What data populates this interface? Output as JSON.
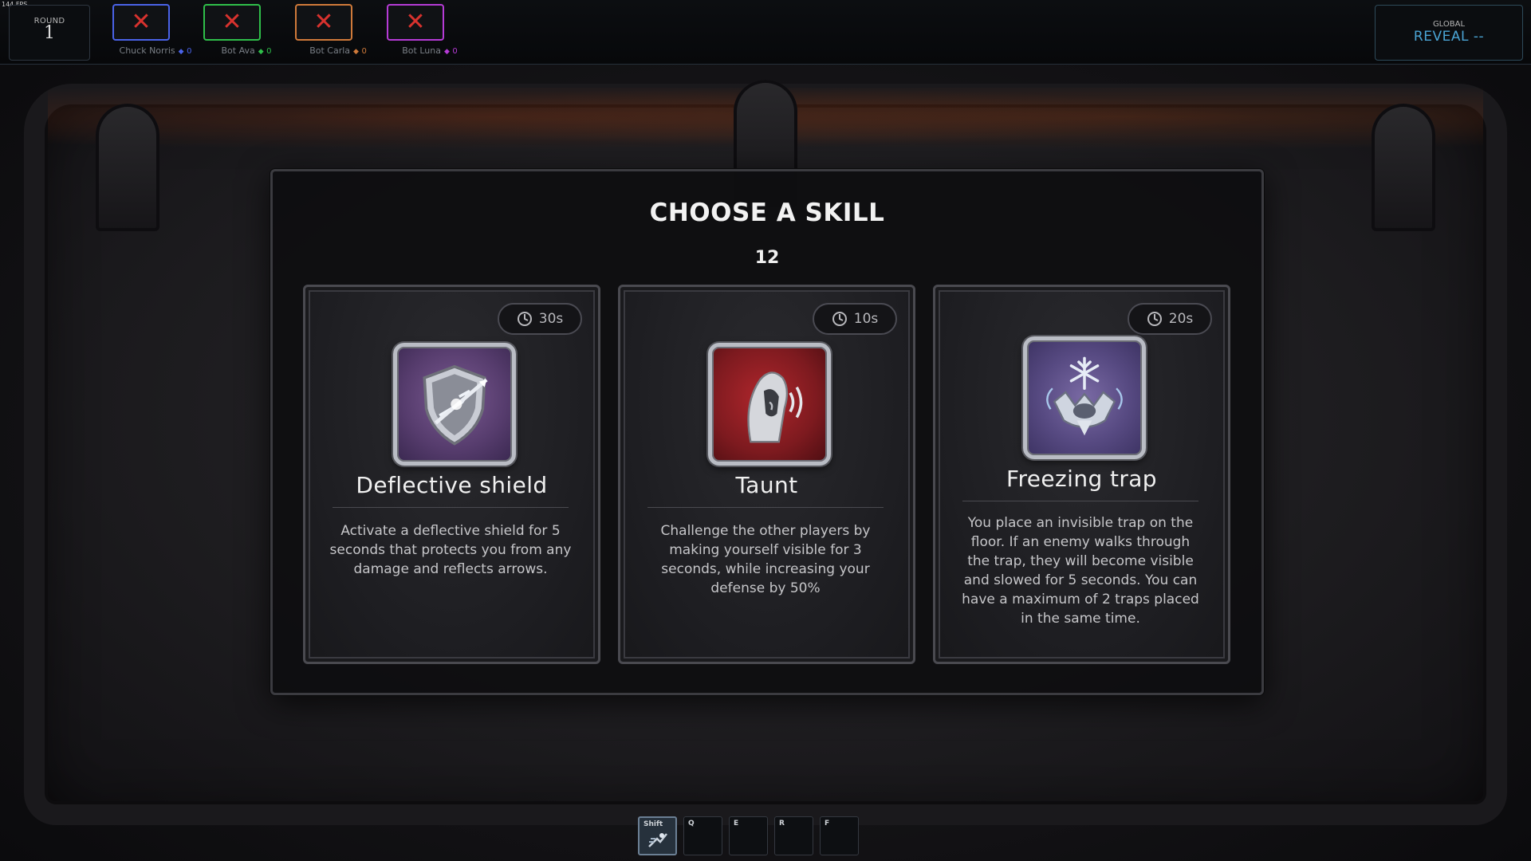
{
  "hud": {
    "fps": "144 FPS",
    "round_label": "ROUND",
    "round_value": "1",
    "global_label": "GLOBAL",
    "global_value": "REVEAL --",
    "players": [
      {
        "name": "Chuck Norris",
        "score": "0",
        "color": "#4a63e8"
      },
      {
        "name": "Bot Ava",
        "score": "0",
        "color": "#2fbf4a"
      },
      {
        "name": "Bot Carla",
        "score": "0",
        "color": "#d07a3a"
      },
      {
        "name": "Bot Luna",
        "score": "0",
        "color": "#b63bd6"
      }
    ],
    "eliminated_icon": "close-x-icon"
  },
  "modal": {
    "title": "CHOOSE A SKILL",
    "timer": "12",
    "cards": [
      {
        "name": "Deflective shield",
        "cooldown": "30s",
        "icon": "shield-arrow-icon",
        "description": "Activate a deflective shield for 5 seconds that protects you from any damage and reflects arrows."
      },
      {
        "name": "Taunt",
        "cooldown": "10s",
        "icon": "hooded-shout-icon",
        "description": "Challenge the other players by making yourself visible for 3 seconds, while increasing your defense by 50%"
      },
      {
        "name": "Freezing trap",
        "cooldown": "20s",
        "icon": "snowflake-trap-icon",
        "description": "You place an invisible trap on the floor. If an enemy walks through the trap, they will become visible and slowed for 5 seconds. You can have a maximum of 2 traps placed in the same time."
      }
    ]
  },
  "hotbar": {
    "slots": [
      {
        "key": "Shift",
        "icon": "dash-icon"
      },
      {
        "key": "Q",
        "icon": ""
      },
      {
        "key": "E",
        "icon": ""
      },
      {
        "key": "R",
        "icon": ""
      },
      {
        "key": "F",
        "icon": ""
      }
    ]
  }
}
